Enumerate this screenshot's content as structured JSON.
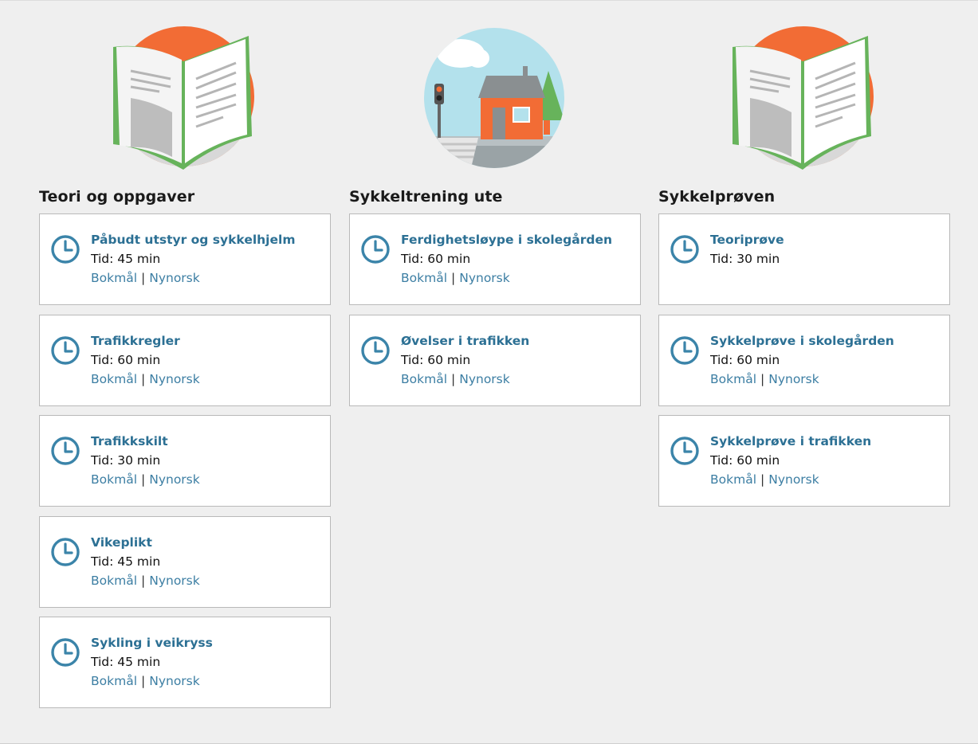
{
  "colors": {
    "background": "#efefef",
    "heading": "#1a1a1a",
    "title_link": "#2c7094",
    "lang_link": "#3c7ea3",
    "card_border": "#b9b9b9",
    "clock": "#3b84a9",
    "orange": "#f26c35",
    "green": "#67b35b"
  },
  "columns": [
    {
      "heading": "Teori og oppgaver",
      "illustration": "newspaper-illustration",
      "cards": [
        {
          "title": "Påbudt utstyr og sykkelhjelm",
          "time": "Tid: 45 min",
          "langs": [
            "Bokmål",
            "Nynorsk"
          ],
          "separator": "|"
        },
        {
          "title": "Trafikkregler",
          "time": "Tid: 60 min",
          "langs": [
            "Bokmål",
            "Nynorsk"
          ],
          "separator": "|"
        },
        {
          "title": "Trafikkskilt",
          "time": "Tid: 30 min",
          "langs": [
            "Bokmål",
            "Nynorsk"
          ],
          "separator": "|"
        },
        {
          "title": "Vikeplikt",
          "time": "Tid: 45 min",
          "langs": [
            "Bokmål",
            "Nynorsk"
          ],
          "separator": "|"
        },
        {
          "title": "Sykling i veikryss",
          "time": "Tid: 45 min",
          "langs": [
            "Bokmål",
            "Nynorsk"
          ],
          "separator": "|"
        }
      ]
    },
    {
      "heading": "Sykkeltrening ute",
      "illustration": "house-street-illustration",
      "cards": [
        {
          "title": "Ferdighetsløype i skolegården",
          "time": "Tid: 60 min",
          "langs": [
            "Bokmål",
            "Nynorsk"
          ],
          "separator": "|"
        },
        {
          "title": "Øvelser i trafikken",
          "time": "Tid: 60 min",
          "langs": [
            "Bokmål",
            "Nynorsk"
          ],
          "separator": "|"
        }
      ]
    },
    {
      "heading": "Sykkelprøven",
      "illustration": "newspaper-illustration",
      "cards": [
        {
          "title": "Teoriprøve",
          "time": "Tid: 30 min",
          "langs": [],
          "separator": ""
        },
        {
          "title": "Sykkelprøve i skolegården",
          "time": "Tid: 60 min",
          "langs": [
            "Bokmål",
            "Nynorsk"
          ],
          "separator": "|"
        },
        {
          "title": "Sykkelprøve i trafikken",
          "time": "Tid: 60 min",
          "langs": [
            "Bokmål",
            "Nynorsk"
          ],
          "separator": "|"
        }
      ]
    }
  ]
}
